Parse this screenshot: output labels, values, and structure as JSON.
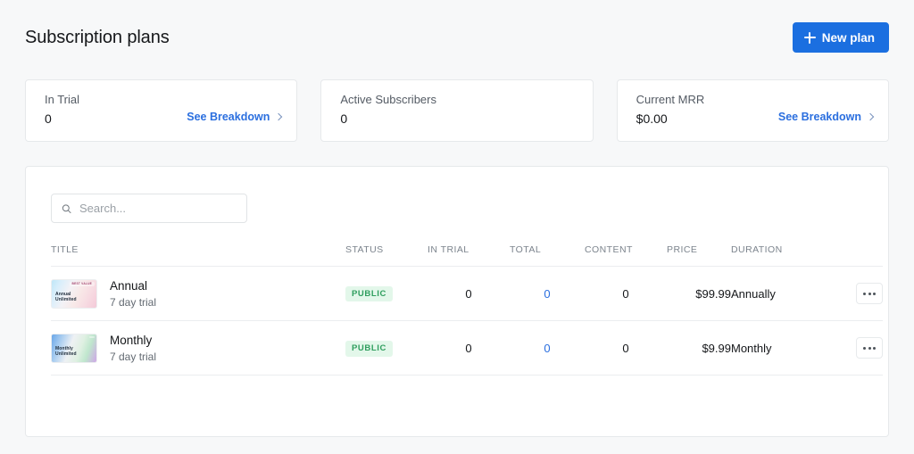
{
  "header": {
    "title": "Subscription plans",
    "new_plan_label": "New plan",
    "plus_icon": "plus-icon",
    "accent_color": "#1b6fe0"
  },
  "stats": [
    {
      "label": "In Trial",
      "value": "0",
      "link_label": "See Breakdown",
      "has_link": true
    },
    {
      "label": "Active Subscribers",
      "value": "0",
      "link_label": "",
      "has_link": false
    },
    {
      "label": "Current MRR",
      "value": "$0.00",
      "link_label": "See Breakdown",
      "has_link": true
    }
  ],
  "search": {
    "value": "",
    "placeholder": "Search...",
    "icon": "search-icon"
  },
  "table": {
    "columns": {
      "title": "TITLE",
      "status": "STATUS",
      "in_trial": "IN TRIAL",
      "total": "TOTAL",
      "content": "CONTENT",
      "price": "PRICE",
      "duration": "DURATION"
    },
    "rows": [
      {
        "thumb_title": "Annual",
        "thumb_subtitle": "Unlimited",
        "thumb_badge": "BEST VALUE",
        "title": "Annual",
        "subtitle": "7 day trial",
        "status": "PUBLIC",
        "in_trial": "0",
        "total": "0",
        "content": "0",
        "price": "$99.99",
        "duration": "Annually",
        "actions_icon": "ellipsis-icon"
      },
      {
        "thumb_title": "Monthly",
        "thumb_subtitle": "Unlimited",
        "thumb_badge": "",
        "title": "Monthly",
        "subtitle": "7 day trial",
        "status": "PUBLIC",
        "in_trial": "0",
        "total": "0",
        "content": "0",
        "price": "$9.99",
        "duration": "Monthly",
        "actions_icon": "ellipsis-icon"
      }
    ]
  },
  "colors": {
    "accent_blue": "#2b6fdf",
    "status_green_text": "#2f9e5e",
    "status_green_bg": "#e3f7ea",
    "page_bg": "#f7f8f9",
    "panel_bg": "#ffffff",
    "border": "#e6e9eb"
  }
}
